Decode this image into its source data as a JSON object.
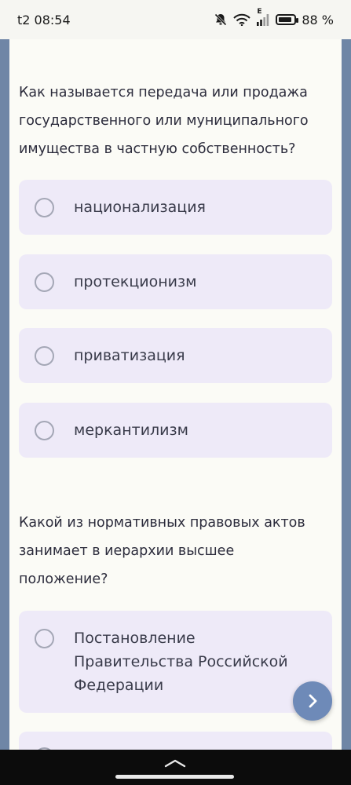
{
  "status_bar": {
    "time": "t2 08:54",
    "network_label": "E",
    "battery_percent": "88 %",
    "battery_level": 0.88,
    "icons": [
      "mute-notifications-icon",
      "wifi-icon",
      "signal-icon",
      "battery-icon"
    ]
  },
  "quiz": {
    "questions": [
      {
        "text": "Как называется передача или продажа государственного или муниципального имущества в частную собственность?",
        "options": [
          "национализация",
          "протекционизм",
          "приватизация",
          "меркантилизм"
        ]
      },
      {
        "text": "Какой из нормативных правовых актов занимает в иерархии высшее положение?",
        "options": [
          "Постановление Правительства Российской Федерации"
        ]
      }
    ]
  },
  "next_button": {
    "icon": "chevron-right-icon"
  },
  "system_nav": {
    "icon": "chevron-up-icon"
  },
  "colors": {
    "background": "#6f86a6",
    "card": "#fbfbf6",
    "option": "#eeeaf8",
    "fab": "#6e8ab8"
  }
}
